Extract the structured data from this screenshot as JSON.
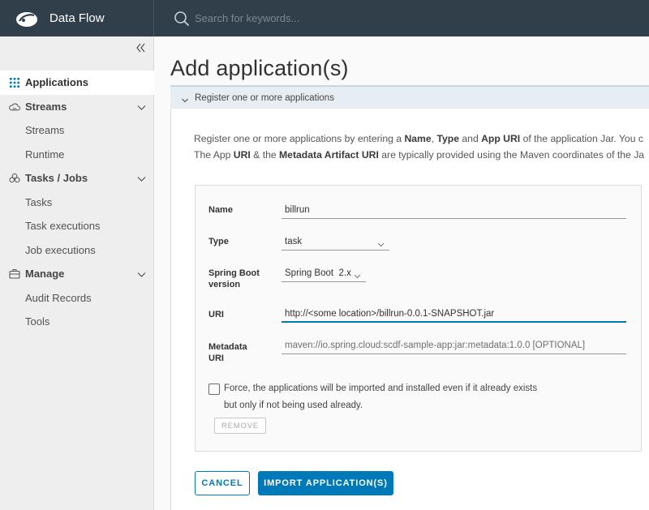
{
  "header": {
    "app_title": "Data Flow",
    "search_placeholder": "Search for keywords..."
  },
  "sidebar": {
    "items": [
      {
        "label": "Applications",
        "icon": "apps-grid-icon",
        "type": "top",
        "active": true
      },
      {
        "label": "Streams",
        "icon": "cloud-streams-icon",
        "type": "group",
        "expanded": true
      },
      {
        "label": "Streams",
        "type": "child"
      },
      {
        "label": "Runtime",
        "type": "child"
      },
      {
        "label": "Tasks / Jobs",
        "icon": "tasks-jobs-icon",
        "type": "group",
        "expanded": true
      },
      {
        "label": "Tasks",
        "type": "child"
      },
      {
        "label": "Task executions",
        "type": "child"
      },
      {
        "label": "Job executions",
        "type": "child"
      },
      {
        "label": "Manage",
        "icon": "briefcase-icon",
        "type": "group",
        "expanded": true
      },
      {
        "label": "Audit Records",
        "type": "child"
      },
      {
        "label": "Tools",
        "type": "child"
      }
    ]
  },
  "main": {
    "title": "Add application(s)",
    "accordion_label": "Register one or more applications",
    "intro": {
      "l1_a": "Register one or more applications by entering a ",
      "l1_b": "Name",
      "l1_c": ", ",
      "l1_d": "Type",
      "l1_e": " and ",
      "l1_f": "App URI",
      "l1_g": " of the application Jar. You c",
      "l2_a": "The App ",
      "l2_b": "URI",
      "l2_c": " & the ",
      "l2_d": "Metadata Artifact URI",
      "l2_e": " are typically provided using the Maven coordinates of the Ja"
    },
    "form": {
      "name_label": "Name",
      "name_value": "billrun",
      "type_label": "Type",
      "type_value": "task",
      "boot_label_1": "Spring Boot",
      "boot_label_2": "version",
      "boot_value": "Spring Boot  2.x",
      "uri_label": "URI",
      "uri_value": "http://<some location>/billrun-0.0.1-SNAPSHOT.jar",
      "meta_label_1": "Metadata",
      "meta_label_2": "URI",
      "meta_placeholder": "maven://io.spring.cloud:scdf-sample-app:jar:metadata:1.0.0 [OPTIONAL]",
      "force_text_1": "Force, the applications will be imported and installed even if it already exists",
      "force_text_2": "but only if not being used already.",
      "remove_label": "REMOVE"
    },
    "buttons": {
      "cancel": "CANCEL",
      "import": "IMPORT APPLICATION(S)"
    }
  },
  "colors": {
    "header_bg": "#313f4b",
    "primary": "#0079b8",
    "sidebar_bg": "#eeeeee",
    "accordion_bg": "#e7eef3"
  }
}
